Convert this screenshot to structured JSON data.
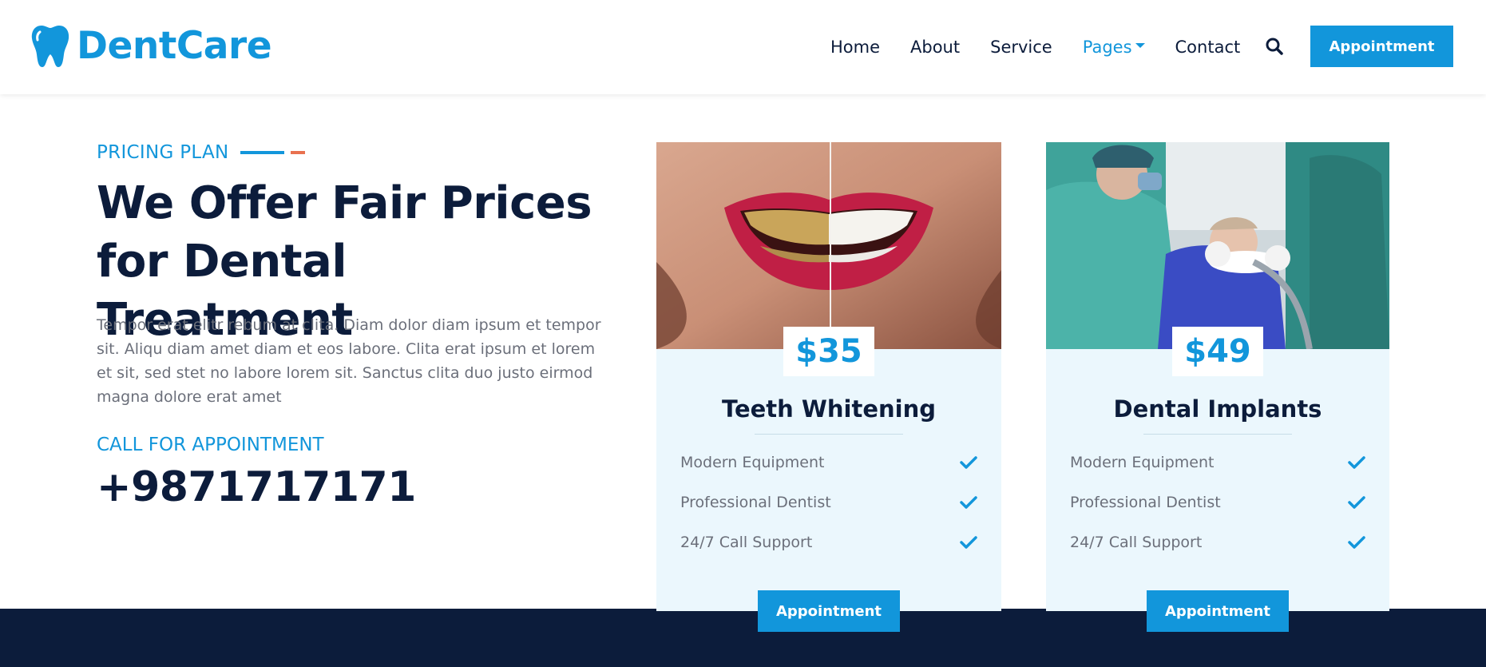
{
  "navbar": {
    "brand": "DentCare",
    "links": [
      "Home",
      "About",
      "Service",
      "Pages",
      "Contact"
    ],
    "active_link": "Pages",
    "cta": "Appointment"
  },
  "hero": {
    "eyebrow": "PRICING PLAN",
    "headline_line1": "We Offer Fair Prices",
    "headline_line2": "for Dental Treatment",
    "body": "Tempor erat elitr rebum at clita. Diam dolor diam ipsum et tempor sit. Aliqu diam amet diam et eos labore. Clita erat ipsum et lorem et sit, sed stet no labore lorem sit. Sanctus clita duo justo eirmod magna dolore erat amet",
    "call_label": "CALL FOR APPOINTMENT",
    "phone": "+9871717171"
  },
  "pricing": [
    {
      "price": "$35",
      "title": "Teeth Whitening",
      "features": [
        "Modern Equipment",
        "Professional Dentist",
        "24/7 Call Support"
      ],
      "button": "Appointment"
    },
    {
      "price": "$49",
      "title": "Dental Implants",
      "features": [
        "Modern Equipment",
        "Professional Dentist",
        "24/7 Call Support"
      ],
      "button": "Appointment"
    }
  ],
  "colors": {
    "primary": "#1296db",
    "dark": "#0c1c3b",
    "accent": "#e9714f",
    "card_bg": "#ebf7fd",
    "muted_text": "#6b6f7a"
  },
  "icons": {
    "brand": "tooth-icon",
    "search": "search-icon",
    "feature": "check-icon",
    "dropdown": "caret-down-icon"
  }
}
